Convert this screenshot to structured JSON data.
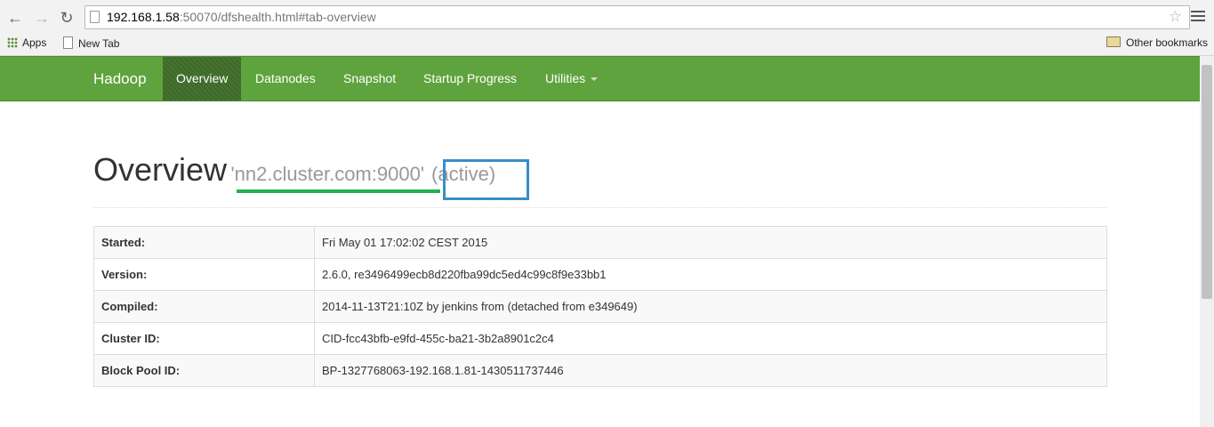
{
  "browser": {
    "url_host": "192.168.1.58",
    "url_rest": ":50070/dfshealth.html#tab-overview",
    "bookmarks": {
      "apps": "Apps",
      "new_tab": "New Tab",
      "other": "Other bookmarks"
    }
  },
  "navbar": {
    "brand": "Hadoop",
    "items": [
      {
        "label": "Overview",
        "active": true
      },
      {
        "label": "Datanodes"
      },
      {
        "label": "Snapshot"
      },
      {
        "label": "Startup Progress"
      },
      {
        "label": "Utilities",
        "dropdown": true
      }
    ],
    "color": "#5fa33e"
  },
  "header": {
    "title": "Overview",
    "host": "'nn2.cluster.com:9000'",
    "state": "(active)"
  },
  "annotations": {
    "host_underline_color": "#22b14c",
    "state_box_color": "#3a8ec7"
  },
  "overview_table": [
    {
      "key": "Started:",
      "value": "Fri May 01 17:02:02 CEST 2015"
    },
    {
      "key": "Version:",
      "value": "2.6.0, re3496499ecb8d220fba99dc5ed4c99c8f9e33bb1"
    },
    {
      "key": "Compiled:",
      "value": "2014-11-13T21:10Z by jenkins from (detached from e349649)"
    },
    {
      "key": "Cluster ID:",
      "value": "CID-fcc43bfb-e9fd-455c-ba21-3b2a8901c2c4"
    },
    {
      "key": "Block Pool ID:",
      "value": "BP-1327768063-192.168.1.81-1430511737446"
    }
  ]
}
